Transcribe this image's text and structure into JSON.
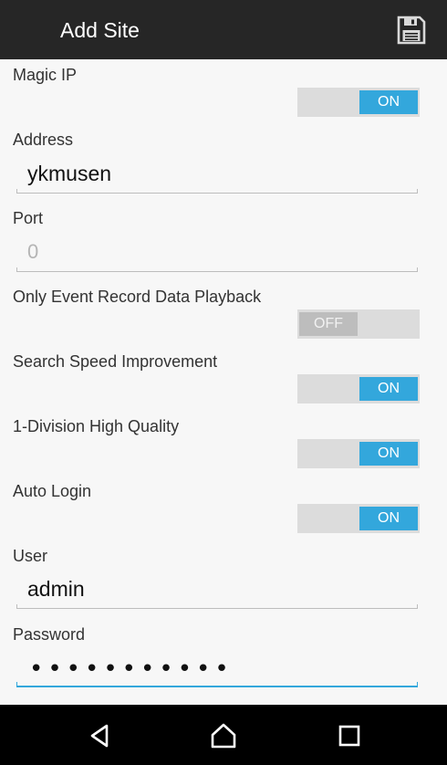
{
  "appbar": {
    "title": "Add Site",
    "save_icon": "floppy-disk-save-icon"
  },
  "magic_ip": {
    "label": "Magic IP",
    "state": "ON"
  },
  "address": {
    "label": "Address",
    "value": "ykmusen"
  },
  "port": {
    "label": "Port",
    "placeholder": "0"
  },
  "event_playback": {
    "label": "Only Event Record Data Playback",
    "state": "OFF"
  },
  "search_speed": {
    "label": "Search Speed Improvement",
    "state": "ON"
  },
  "division_hq": {
    "label": "1-Division High Quality",
    "state": "ON"
  },
  "auto_login": {
    "label": "Auto Login",
    "state": "ON"
  },
  "user": {
    "label": "User",
    "value": "admin"
  },
  "password": {
    "label": "Password",
    "masked_value": "•••••••••••"
  },
  "colors": {
    "accent": "#33a7dc",
    "appbar": "#262626",
    "navbar": "#000000"
  },
  "navbar": {
    "back_icon": "back-triangle-icon",
    "home_icon": "home-icon",
    "recents_icon": "recents-square-icon"
  }
}
